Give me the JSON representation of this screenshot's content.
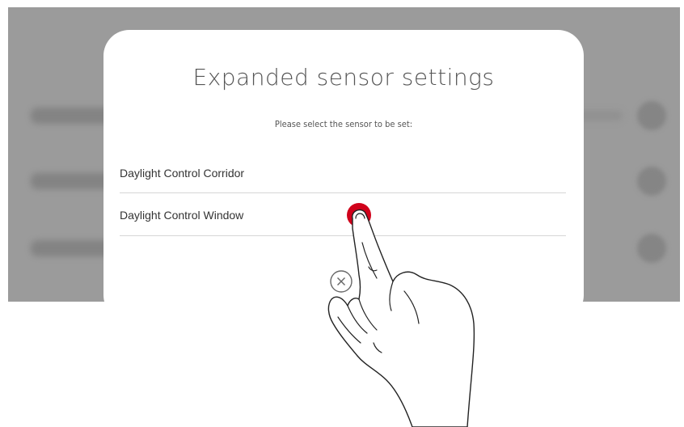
{
  "dialog": {
    "title": "Expanded sensor settings",
    "subtitle": "Please select the sensor to be set:",
    "options": [
      {
        "label": "Daylight Control Corridor"
      },
      {
        "label": "Daylight Control Window"
      }
    ],
    "close_icon": "close-circle-icon"
  },
  "overlay": {
    "hand_icon": "pointing-hand-icon",
    "touch_indicator_color": "#d0021b"
  }
}
